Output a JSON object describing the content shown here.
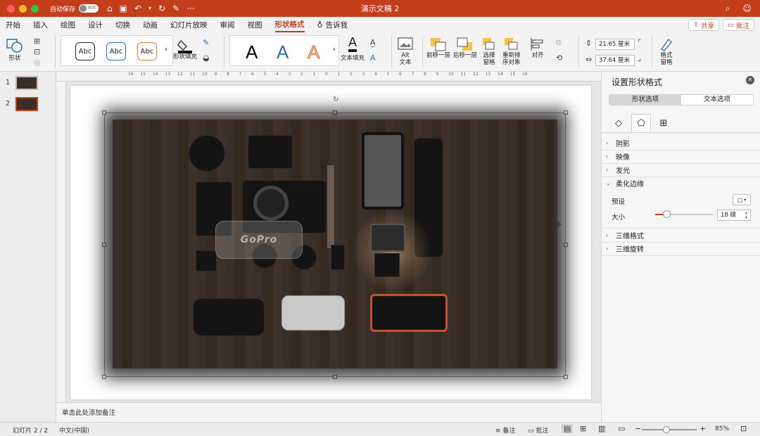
{
  "titlebar": {
    "autosave_label": "自动保存",
    "autosave_state": "关闭",
    "title": "演示文稿 2"
  },
  "tabs": [
    {
      "label": "开始",
      "active": false
    },
    {
      "label": "插入",
      "active": false
    },
    {
      "label": "绘图",
      "active": false
    },
    {
      "label": "设计",
      "active": false
    },
    {
      "label": "切换",
      "active": false
    },
    {
      "label": "动画",
      "active": false
    },
    {
      "label": "幻灯片放映",
      "active": false
    },
    {
      "label": "审阅",
      "active": false
    },
    {
      "label": "视图",
      "active": false
    },
    {
      "label": "形状格式",
      "active": true
    },
    {
      "label": "告诉我",
      "active": false
    }
  ],
  "share_label": "共享",
  "comment_label": "批注",
  "ribbon": {
    "shape_label": "形状",
    "abc1": "Abc",
    "abc2": "Abc",
    "abc3": "Abc",
    "shape_fill_label": "形状填充",
    "wordart_letter": "A",
    "text_fill_label": "文本填充",
    "alt_text_line1": "Alt",
    "alt_text_line2": "文本",
    "bring_forward": "前移一层",
    "send_backward": "后移一层",
    "selection_pane_line1": "选择",
    "selection_pane_line2": "窗格",
    "reorder_line1": "重新排",
    "reorder_line2": "序对象",
    "align_label": "对齐",
    "height_value": "21.65 厘米",
    "width_value": "37.64 厘米",
    "format_pane_line1": "格式",
    "format_pane_line2": "窗格"
  },
  "slides": [
    {
      "number": "1",
      "active": false
    },
    {
      "number": "2",
      "active": true
    }
  ],
  "ruler_ticks": [
    "16",
    "15",
    "14",
    "13",
    "12",
    "11",
    "10",
    "9",
    "8",
    "7",
    "6",
    "5",
    "4",
    "3",
    "2",
    "1",
    "0",
    "1",
    "2",
    "3",
    "4",
    "5",
    "6",
    "7",
    "8",
    "9",
    "10",
    "11",
    "12",
    "13",
    "14",
    "15",
    "16"
  ],
  "photo_text": "GoPro",
  "notes_placeholder": "单击此处添加备注",
  "pane": {
    "title": "设置形状格式",
    "seg_shape": "形状选项",
    "seg_text": "文本选项",
    "sections": [
      {
        "label": "阴影",
        "expanded": false
      },
      {
        "label": "映像",
        "expanded": false
      },
      {
        "label": "发光",
        "expanded": false
      },
      {
        "label": "柔化边缘",
        "expanded": true
      },
      {
        "label": "三维格式",
        "expanded": false
      },
      {
        "label": "三维旋转",
        "expanded": false
      }
    ],
    "preset_label": "预设",
    "size_label": "大小",
    "size_value": "18 磅",
    "size_slider_fraction": 0.2
  },
  "status": {
    "slide_info": "幻灯片 2 / 2",
    "language": "中文(中国)",
    "notes": "备注",
    "comments": "批注",
    "zoom": "85%",
    "zoom_fraction": 0.45
  },
  "colors": {
    "accent": "#c43e1c"
  }
}
